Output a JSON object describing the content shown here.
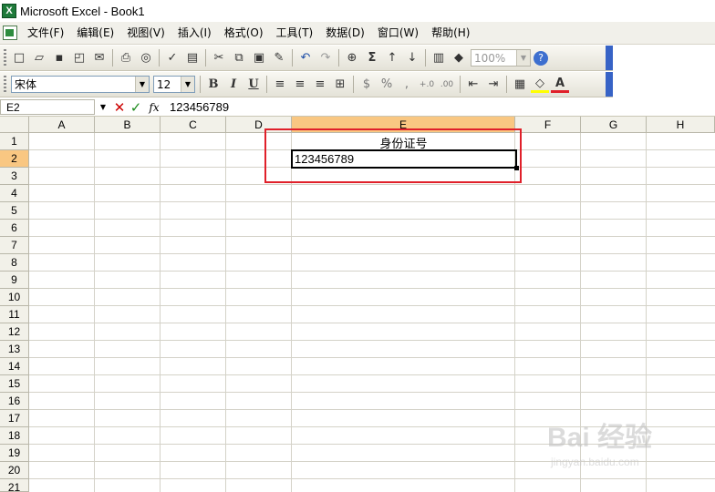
{
  "window": {
    "title": "Microsoft Excel - Book1"
  },
  "menu": [
    "文件(F)",
    "编辑(E)",
    "视图(V)",
    "插入(I)",
    "格式(O)",
    "工具(T)",
    "数据(D)",
    "窗口(W)",
    "帮助(H)"
  ],
  "toolbar_standard": {
    "zoom": "100%",
    "icons": [
      "new-icon",
      "open-icon",
      "save-icon",
      "permission-icon",
      "email-icon",
      "print-icon",
      "print-preview-icon",
      "spelling-icon",
      "research-icon",
      "cut-icon",
      "copy-icon",
      "paste-icon",
      "format-painter-icon",
      "undo-icon",
      "redo-icon",
      "hyperlink-icon",
      "autosum-icon",
      "sort-ascending-icon",
      "sort-descending-icon",
      "chart-icon",
      "drawing-icon",
      "help-icon"
    ]
  },
  "toolbar_formatting": {
    "font_name": "宋体",
    "font_size": "12",
    "bold": "B",
    "italic": "I",
    "underline": "U",
    "currency": "$",
    "percent": "%",
    "comma": ",",
    "increase_decimal": "+.0",
    "decrease_decimal": ".00",
    "font_color_label": "A"
  },
  "formula_bar": {
    "name_box": "E2",
    "fx": "fx",
    "content": "123456789"
  },
  "grid": {
    "columns": [
      "A",
      "B",
      "C",
      "D",
      "E",
      "F",
      "G",
      "H"
    ],
    "selected_column": "E",
    "rows": [
      "1",
      "2",
      "3",
      "4",
      "5",
      "6",
      "7",
      "8",
      "9",
      "10",
      "11",
      "12",
      "13",
      "14",
      "15",
      "16",
      "17",
      "18",
      "19",
      "20",
      "21"
    ],
    "selected_row": "2",
    "cells": {
      "E1": "身份证号",
      "E2": "123456789"
    }
  },
  "colors": {
    "highlight_box": "#e0202a",
    "selected_header": "#f9c782",
    "toolbar_accent": "#3763c6"
  },
  "watermark": {
    "text": "Bai 经验",
    "sub": "jingyan.baidu.com"
  }
}
